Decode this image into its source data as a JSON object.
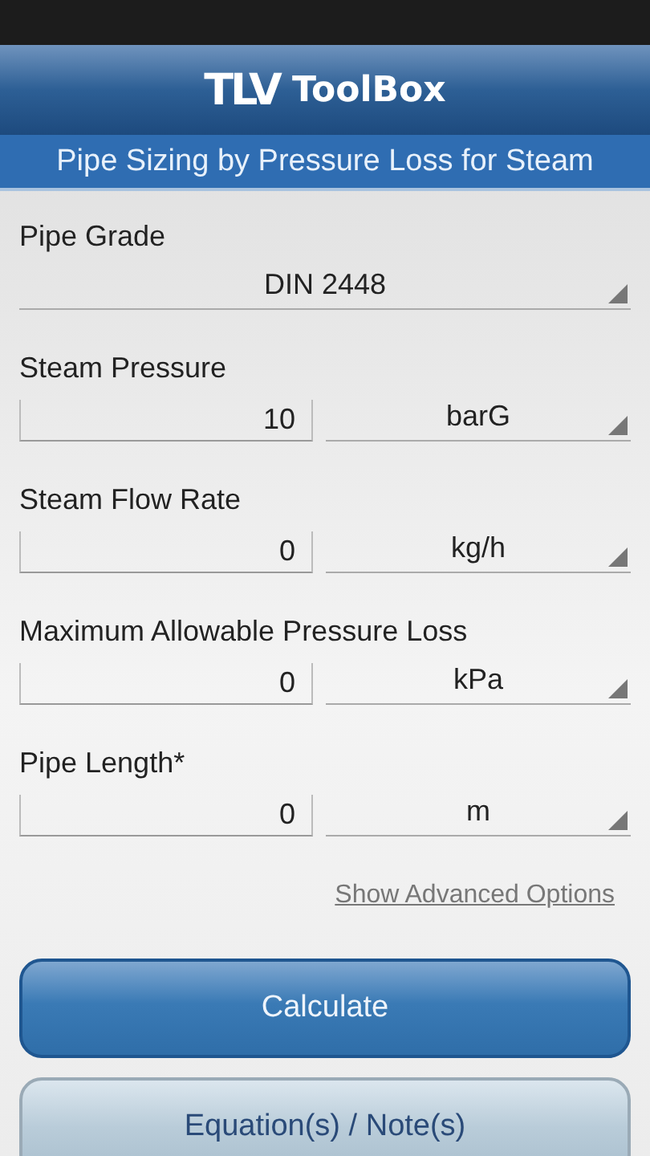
{
  "header": {
    "logo": "TLV",
    "title": "ToolBox"
  },
  "subtitle": "Pipe Sizing by Pressure Loss for Steam",
  "fields": [
    {
      "kind": "select",
      "label": "Pipe Grade",
      "value": "DIN 2448"
    },
    {
      "kind": "number_unit",
      "label": "Steam Pressure",
      "value": "10",
      "unit": "barG"
    },
    {
      "kind": "number_unit",
      "label": "Steam Flow Rate",
      "value": "0",
      "unit": "kg/h"
    },
    {
      "kind": "number_unit",
      "label": "Maximum Allowable Pressure Loss",
      "value": "0",
      "unit": "kPa"
    },
    {
      "kind": "number_unit",
      "label": "Pipe Length*",
      "value": "0",
      "unit": "m"
    }
  ],
  "advanced_link": "Show Advanced Options",
  "buttons": [
    {
      "kind": "primary",
      "label": "Calculate"
    },
    {
      "kind": "secondary",
      "label": "Equation(s) / Note(s)"
    }
  ]
}
